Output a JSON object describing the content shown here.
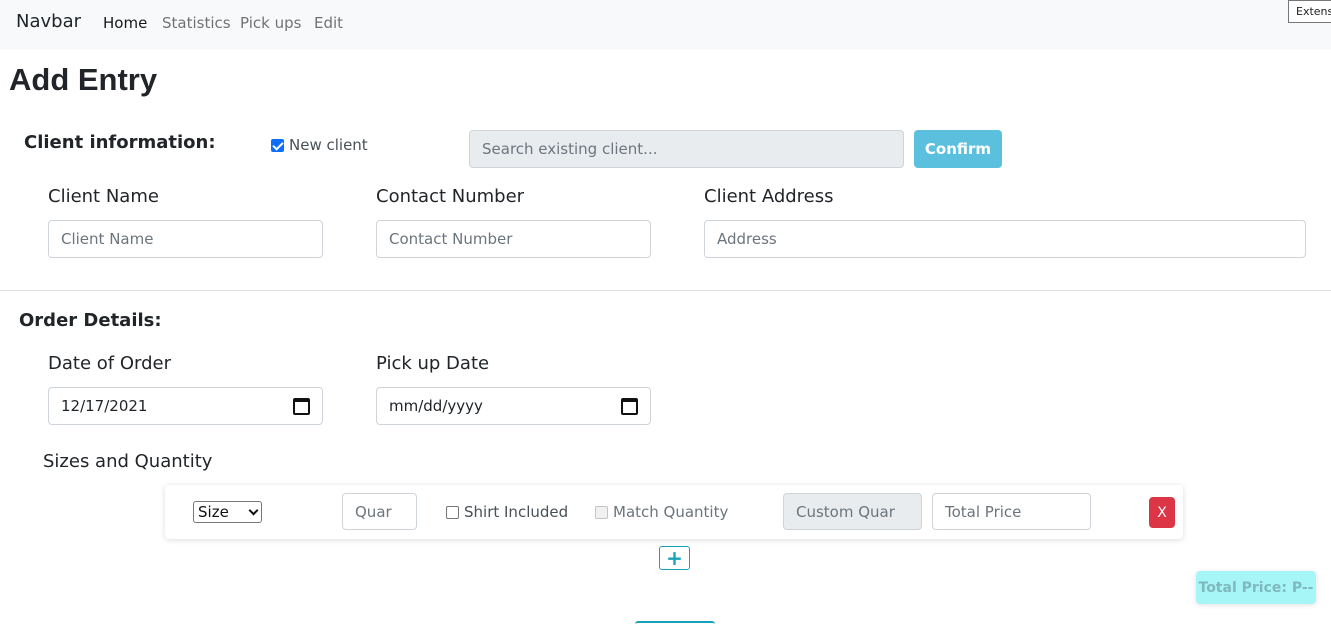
{
  "navbar": {
    "brand": "Navbar",
    "links": [
      {
        "label": "Home",
        "active": true
      },
      {
        "label": "Statistics",
        "active": false
      },
      {
        "label": "Pick ups",
        "active": false
      },
      {
        "label": "Edit",
        "active": false
      }
    ],
    "extension_tag": "Extens"
  },
  "page": {
    "title": "Add Entry"
  },
  "client": {
    "section_title": "Client information:",
    "new_client_label": "New client",
    "new_client_checked": true,
    "search_placeholder": "Search existing client...",
    "confirm_label": "Confirm",
    "fields": {
      "name_label": "Client Name",
      "name_placeholder": "Client Name",
      "contact_label": "Contact Number",
      "contact_placeholder": "Contact Number",
      "address_label": "Client Address",
      "address_placeholder": "Address"
    }
  },
  "order": {
    "section_title": "Order Details:",
    "date_of_order_label": "Date of Order",
    "date_of_order_value": "12/17/2021",
    "pickup_label": "Pick up Date",
    "pickup_placeholder": "mm/dd/yyyy",
    "sizes_label": "Sizes and Quantity",
    "size_row": {
      "size_select": "Size",
      "quantity_placeholder": "Quar",
      "shirt_included_label": "Shirt Included",
      "match_quantity_label": "Match Quantity",
      "custom_quantity_placeholder": "Custom Quar",
      "total_price_placeholder": "Total Price",
      "remove_label": "X"
    },
    "add_size_label": "+"
  },
  "total": {
    "label": "Total Price: P--"
  },
  "colors": {
    "primary": "#0d6efd",
    "info": "#5bc0de",
    "danger": "#dc3545",
    "teal": "#17a2b8",
    "badge": "#a6f5f7"
  }
}
